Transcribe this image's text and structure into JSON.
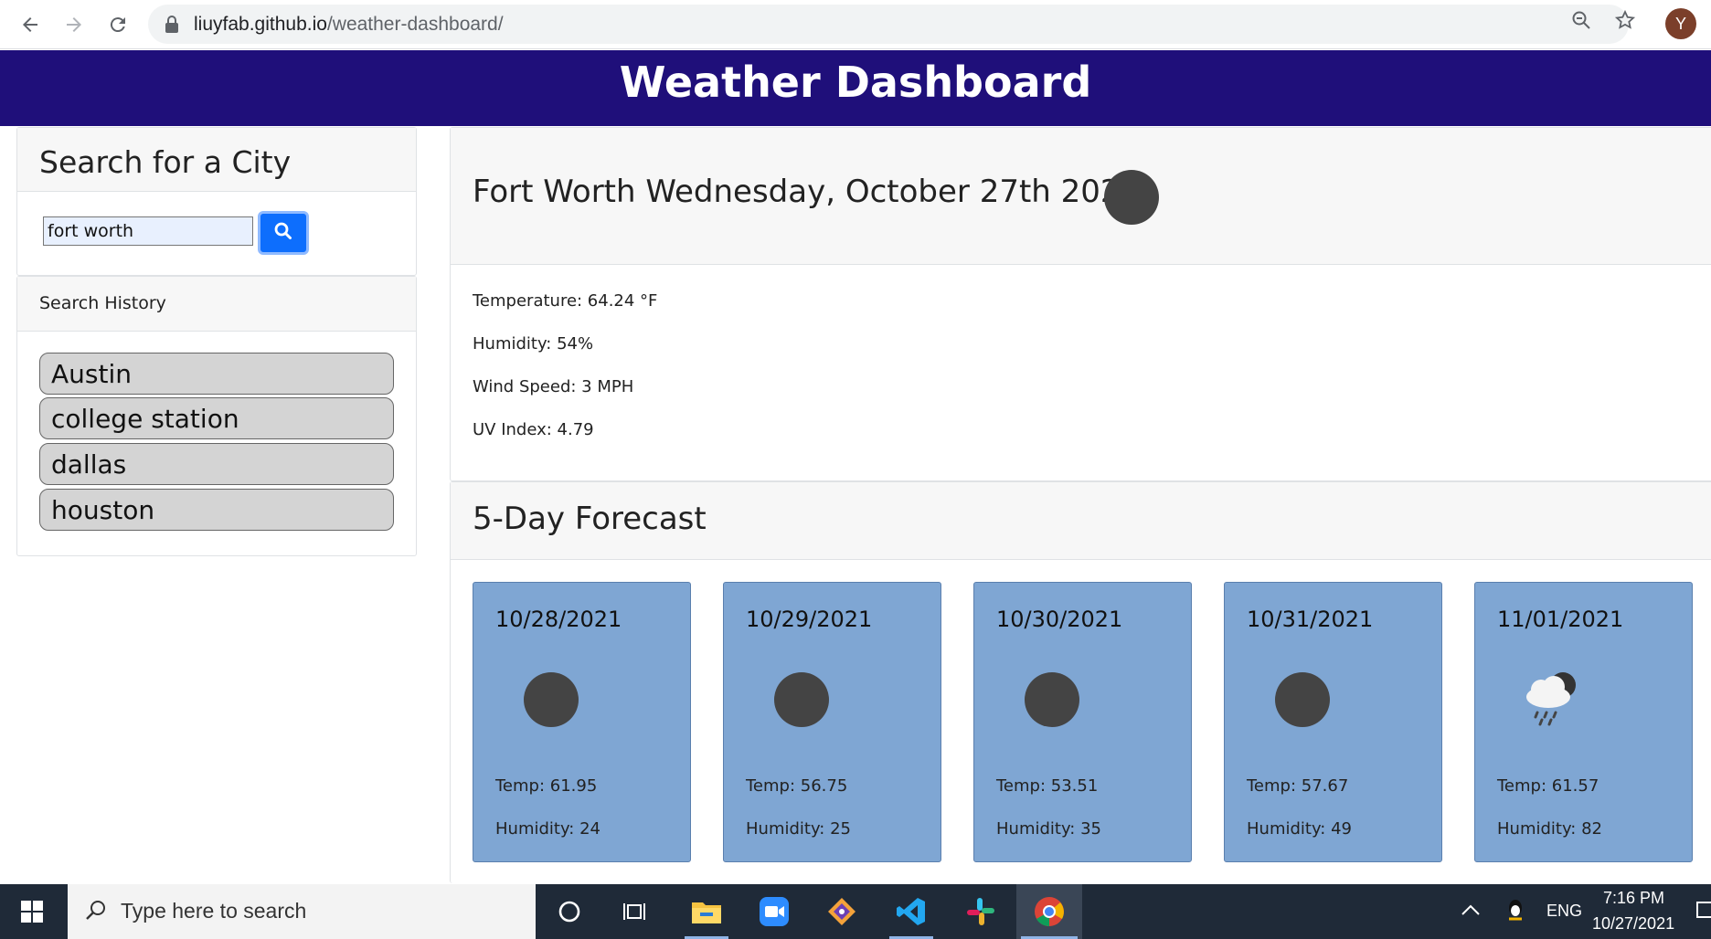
{
  "browser": {
    "url_host": "liuyfab.github.io",
    "url_path": "/weather-dashboard/",
    "profile_initial": "Y"
  },
  "app": {
    "title": "Weather Dashboard"
  },
  "search": {
    "heading": "Search for a City",
    "input_value": "fort worth"
  },
  "history": {
    "heading": "Search History",
    "items": [
      "Austin",
      "college station",
      "dallas",
      "houston"
    ]
  },
  "current": {
    "title": "Fort Worth Wednesday, October 27th 2021",
    "temperature": "Temperature: 64.24 °F",
    "humidity": "Humidity: 54%",
    "wind": "Wind Speed: 3 MPH",
    "uv": "UV Index: 4.79"
  },
  "forecast": {
    "heading": "5-Day Forecast",
    "days": [
      {
        "date": "10/28/2021",
        "temp": "Temp: 61.95",
        "humidity": "Humidity: 24",
        "icon": "moon-icon"
      },
      {
        "date": "10/29/2021",
        "temp": "Temp: 56.75",
        "humidity": "Humidity: 25",
        "icon": "moon-icon"
      },
      {
        "date": "10/30/2021",
        "temp": "Temp: 53.51",
        "humidity": "Humidity: 35",
        "icon": "moon-icon"
      },
      {
        "date": "10/31/2021",
        "temp": "Temp: 57.67",
        "humidity": "Humidity: 49",
        "icon": "moon-icon"
      },
      {
        "date": "11/01/2021",
        "temp": "Temp: 61.57",
        "humidity": "Humidity: 82",
        "icon": "rain-cloud-icon"
      }
    ]
  },
  "colors": {
    "header_bg": "#1f0f7a",
    "forecast_card_bg": "#7fa6d3",
    "search_button": "#0d6efd"
  },
  "taskbar": {
    "search_placeholder": "Type here to search",
    "language": "ENG",
    "time": "7:16 PM",
    "date": "10/27/2021"
  }
}
